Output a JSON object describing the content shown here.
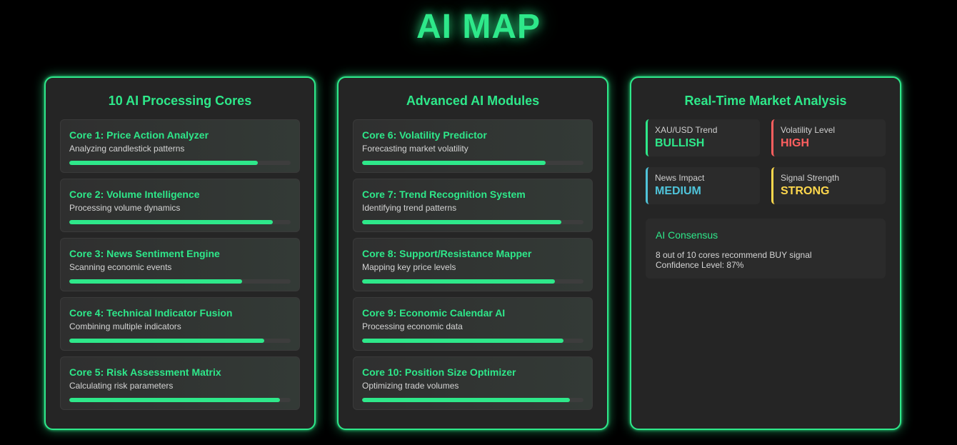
{
  "page": {
    "title": "AI MAP"
  },
  "colors": {
    "accent": "#2ee88a",
    "bullish": "#2ee88a",
    "high": "#ff5f5f",
    "medium": "#4fc3d9",
    "strong": "#ffd84d"
  },
  "cores_panel": {
    "title": "10 AI Processing Cores",
    "cores": [
      {
        "name": "Core 1: Price Action Analyzer",
        "desc": "Analyzing candlestick patterns",
        "progress": 85
      },
      {
        "name": "Core 2: Volume Intelligence",
        "desc": "Processing volume dynamics",
        "progress": 92
      },
      {
        "name": "Core 3: News Sentiment Engine",
        "desc": "Scanning economic events",
        "progress": 78
      },
      {
        "name": "Core 4: Technical Indicator Fusion",
        "desc": "Combining multiple indicators",
        "progress": 88
      },
      {
        "name": "Core 5: Risk Assessment Matrix",
        "desc": "Calculating risk parameters",
        "progress": 95
      }
    ]
  },
  "modules_panel": {
    "title": "Advanced AI Modules",
    "cores": [
      {
        "name": "Core 6: Volatility Predictor",
        "desc": "Forecasting market volatility",
        "progress": 83
      },
      {
        "name": "Core 7: Trend Recognition System",
        "desc": "Identifying trend patterns",
        "progress": 90
      },
      {
        "name": "Core 8: Support/Resistance Mapper",
        "desc": "Mapping key price levels",
        "progress": 87
      },
      {
        "name": "Core 9: Economic Calendar AI",
        "desc": "Processing economic data",
        "progress": 91
      },
      {
        "name": "Core 10: Position Size Optimizer",
        "desc": "Optimizing trade volumes",
        "progress": 94
      }
    ]
  },
  "analysis_panel": {
    "title": "Real-Time Market Analysis",
    "stats": [
      {
        "label": "XAU/USD Trend",
        "value": "BULLISH",
        "color": "#2ee88a"
      },
      {
        "label": "Volatility Level",
        "value": "HIGH",
        "color": "#ff5f5f"
      },
      {
        "label": "News Impact",
        "value": "MEDIUM",
        "color": "#4fc3d9"
      },
      {
        "label": "Signal Strength",
        "value": "STRONG",
        "color": "#ffd84d"
      }
    ],
    "consensus": {
      "title": "AI Consensus",
      "line1": "8 out of 10 cores recommend BUY signal",
      "line2": "Confidence Level: 87%"
    }
  }
}
